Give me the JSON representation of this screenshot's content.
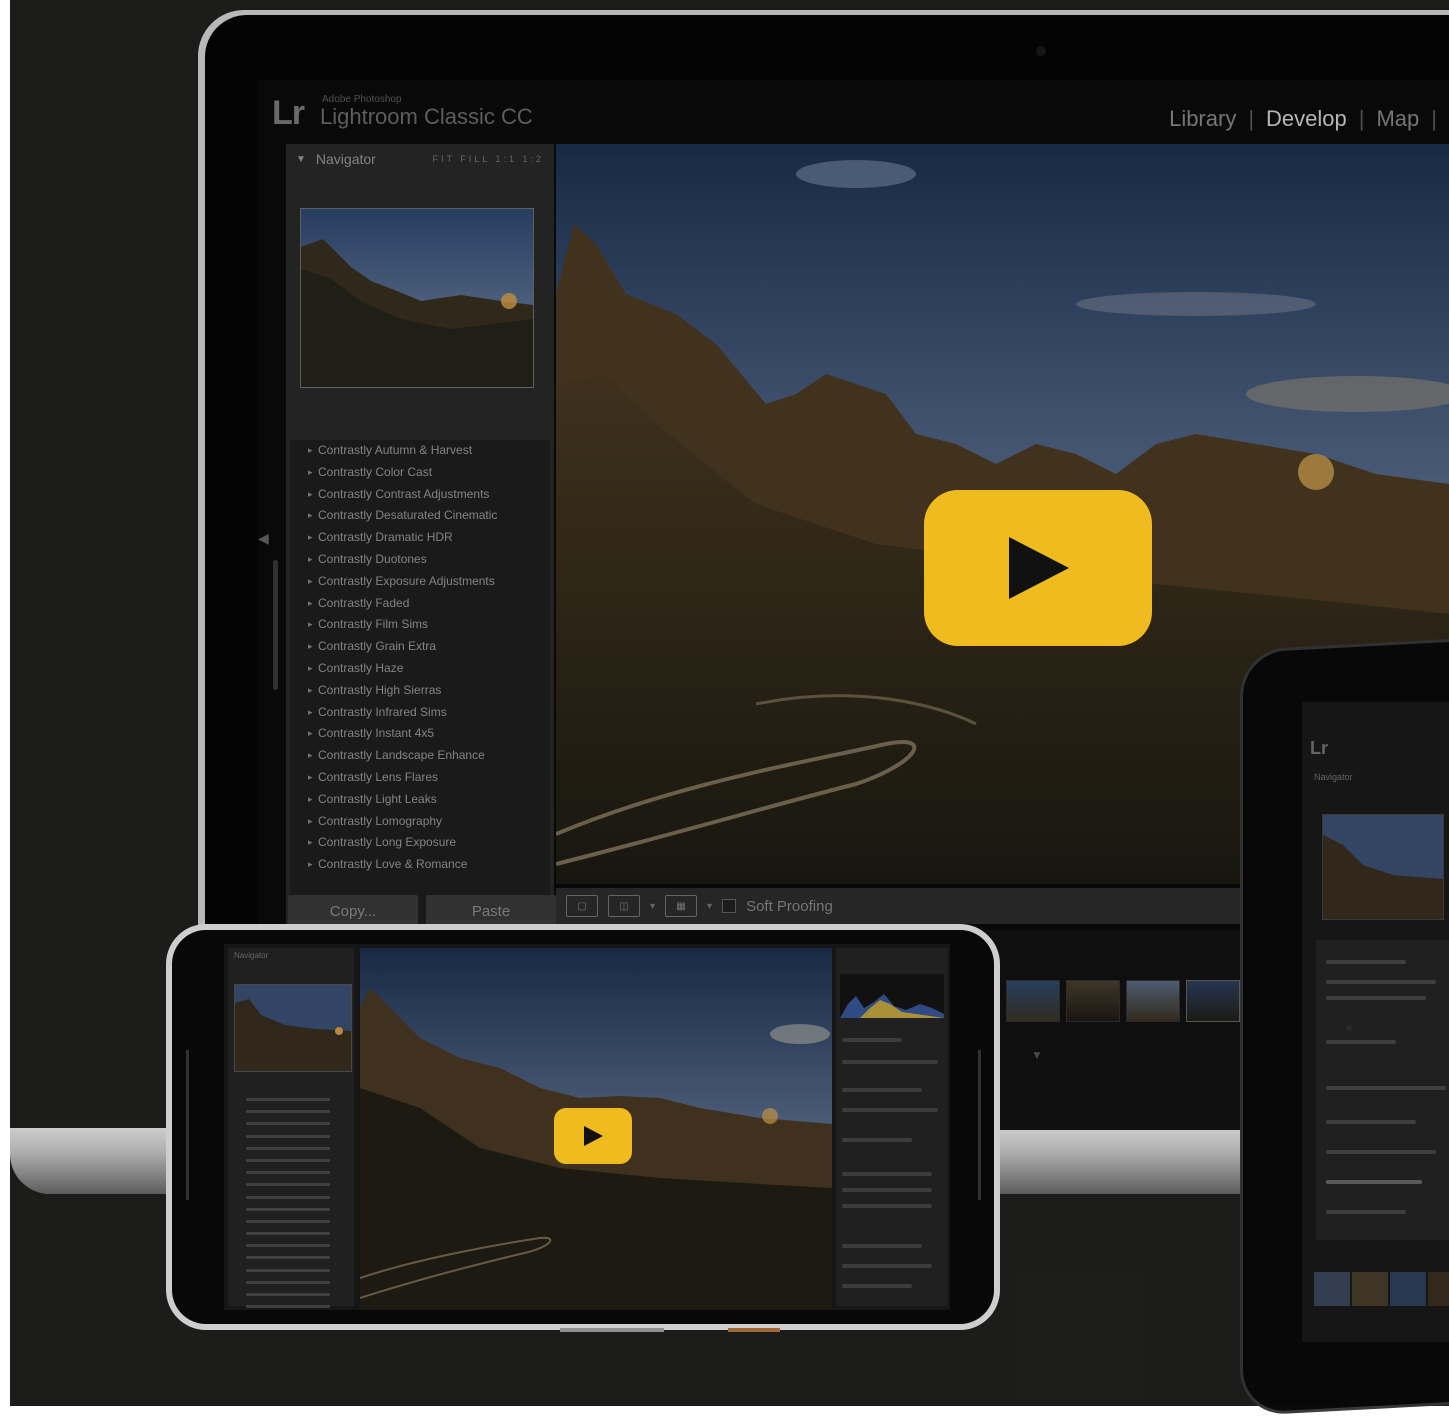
{
  "app": {
    "brand_short": "Lr",
    "brand_sub": "Adobe Photoshop",
    "title": "Lightroom Classic CC"
  },
  "modules": [
    "Library",
    "Develop",
    "Map"
  ],
  "module_separator": "|",
  "active_module": "Develop",
  "navigator": {
    "title": "Navigator",
    "zoom_options": "FIT FILL 1:1 1:2"
  },
  "presets": [
    "Contrastly Autumn & Harvest",
    "Contrastly Color Cast",
    "Contrastly Contrast Adjustments",
    "Contrastly Desaturated Cinematic",
    "Contrastly Dramatic HDR",
    "Contrastly Duotones",
    "Contrastly Exposure Adjustments",
    "Contrastly Faded",
    "Contrastly Film Sims",
    "Contrastly Grain Extra",
    "Contrastly Haze",
    "Contrastly High Sierras",
    "Contrastly Infrared Sims",
    "Contrastly Instant 4x5",
    "Contrastly Landscape Enhance",
    "Contrastly Lens Flares",
    "Contrastly Light Leaks",
    "Contrastly Lomography",
    "Contrastly Long Exposure",
    "Contrastly Love & Romance"
  ],
  "buttons": {
    "copy": "Copy...",
    "paste": "Paste"
  },
  "toolbar": {
    "soft_proofing": "Soft Proofing"
  },
  "colors": {
    "play_accent": "#f0bb1e",
    "background": "#22221f",
    "panel": "#2a2a2a"
  },
  "icons": {
    "play": "play-icon",
    "loupe": "loupe-view-icon",
    "compare": "compare-view-icon",
    "survey": "survey-view-icon"
  }
}
